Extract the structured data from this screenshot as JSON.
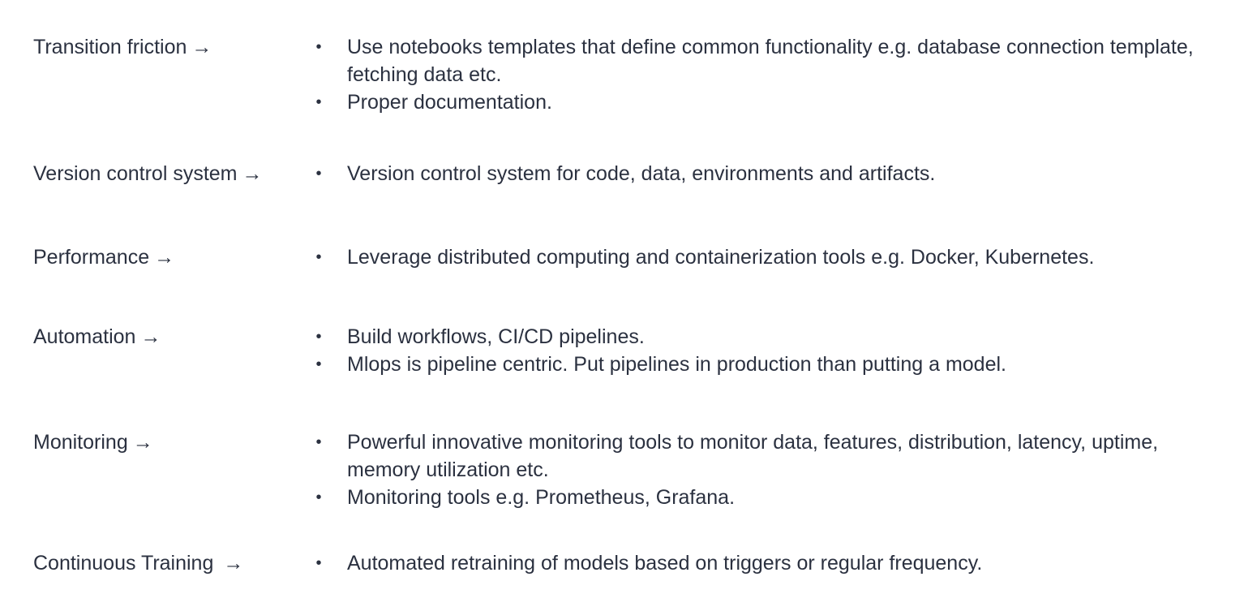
{
  "rows": [
    {
      "label": "Transition friction",
      "arrow": "→",
      "bullets": [
        "Use notebooks templates that define common functionality e.g. database connection template, fetching data etc.",
        "Proper documentation."
      ]
    },
    {
      "label": "Version control system",
      "arrow": "→",
      "bullets": [
        "Version control system for code, data, environments and artifacts."
      ]
    },
    {
      "label": "Performance",
      "arrow": "→",
      "bullets": [
        "Leverage distributed computing and containerization tools e.g. Docker, Kubernetes."
      ]
    },
    {
      "label": "Automation",
      "arrow": "→",
      "bullets": [
        "Build workflows, CI/CD pipelines.",
        "Mlops is pipeline centric. Put pipelines in production than putting a model."
      ]
    },
    {
      "label": "Monitoring",
      "arrow": "→",
      "bullets": [
        "Powerful innovative monitoring tools to monitor data, features, distribution, latency, uptime, memory utilization etc.",
        "Monitoring tools e.g. Prometheus, Grafana."
      ]
    },
    {
      "label": "Continuous Training",
      "arrow": "→",
      "bullets": [
        "Automated retraining of models based on triggers or regular frequency."
      ]
    }
  ],
  "bullet_glyph": "•",
  "colors": {
    "text": "#2b3140",
    "background": "#ffffff"
  }
}
